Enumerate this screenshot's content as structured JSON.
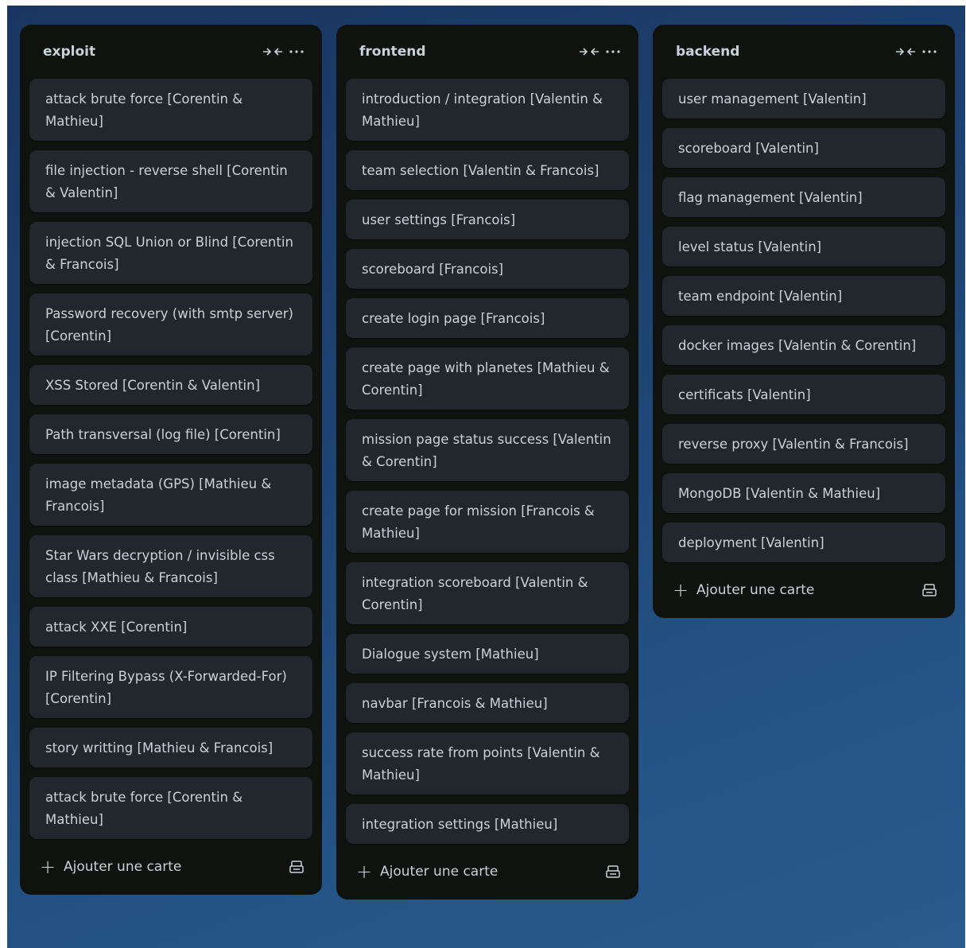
{
  "lists": [
    {
      "title": "exploit",
      "cards": [
        "attack brute force [Corentin & Mathieu]",
        "file injection - reverse shell [Corentin & Valentin]",
        "injection SQL Union or Blind [Corentin & Francois]",
        "Password recovery (with smtp server) [Corentin]",
        "XSS Stored [Corentin & Valentin]",
        "Path transversal (log file) [Corentin]",
        "image metadata (GPS) [Mathieu & Francois]",
        "Star Wars decryption / invisible css class [Mathieu & Francois]",
        "attack XXE [Corentin]",
        "IP Filtering Bypass (X-Forwarded-For) [Corentin]",
        "story writting [Mathieu & Francois]",
        "attack brute force [Corentin & Mathieu]"
      ],
      "add_label": "Ajouter une carte"
    },
    {
      "title": "frontend",
      "cards": [
        "introduction / integration [Valentin & Mathieu]",
        "team selection [Valentin & Francois]",
        "user settings [Francois]",
        "scoreboard [Francois]",
        "create login page [Francois]",
        "create page with planetes [Mathieu & Corentin]",
        "mission page status success [Valentin & Corentin]",
        "create page for mission [Francois & Mathieu]",
        "integration scoreboard [Valentin & Corentin]",
        "Dialogue system [Mathieu]",
        "navbar [Francois & Mathieu]",
        "success rate from points [Valentin & Mathieu]",
        "integration settings [Mathieu]"
      ],
      "add_label": "Ajouter une carte"
    },
    {
      "title": "backend",
      "cards": [
        "user management [Valentin]",
        "scoreboard [Valentin]",
        "flag management [Valentin]",
        "level status [Valentin]",
        "team endpoint [Valentin]",
        "docker images [Valentin & Corentin]",
        "certificats [Valentin]",
        "reverse proxy [Valentin & Francois]",
        "MongoDB [Valentin & Mathieu]",
        "deployment [Valentin]"
      ],
      "add_label": "Ajouter une carte"
    }
  ],
  "icons": {
    "collapse": "collapse-icon",
    "more": "more-icon",
    "add": "plus-icon",
    "template": "card-template-icon"
  },
  "colors": {
    "list_bg": "#0f120e",
    "card_bg": "#22272e",
    "text": "#c9d1d9"
  }
}
